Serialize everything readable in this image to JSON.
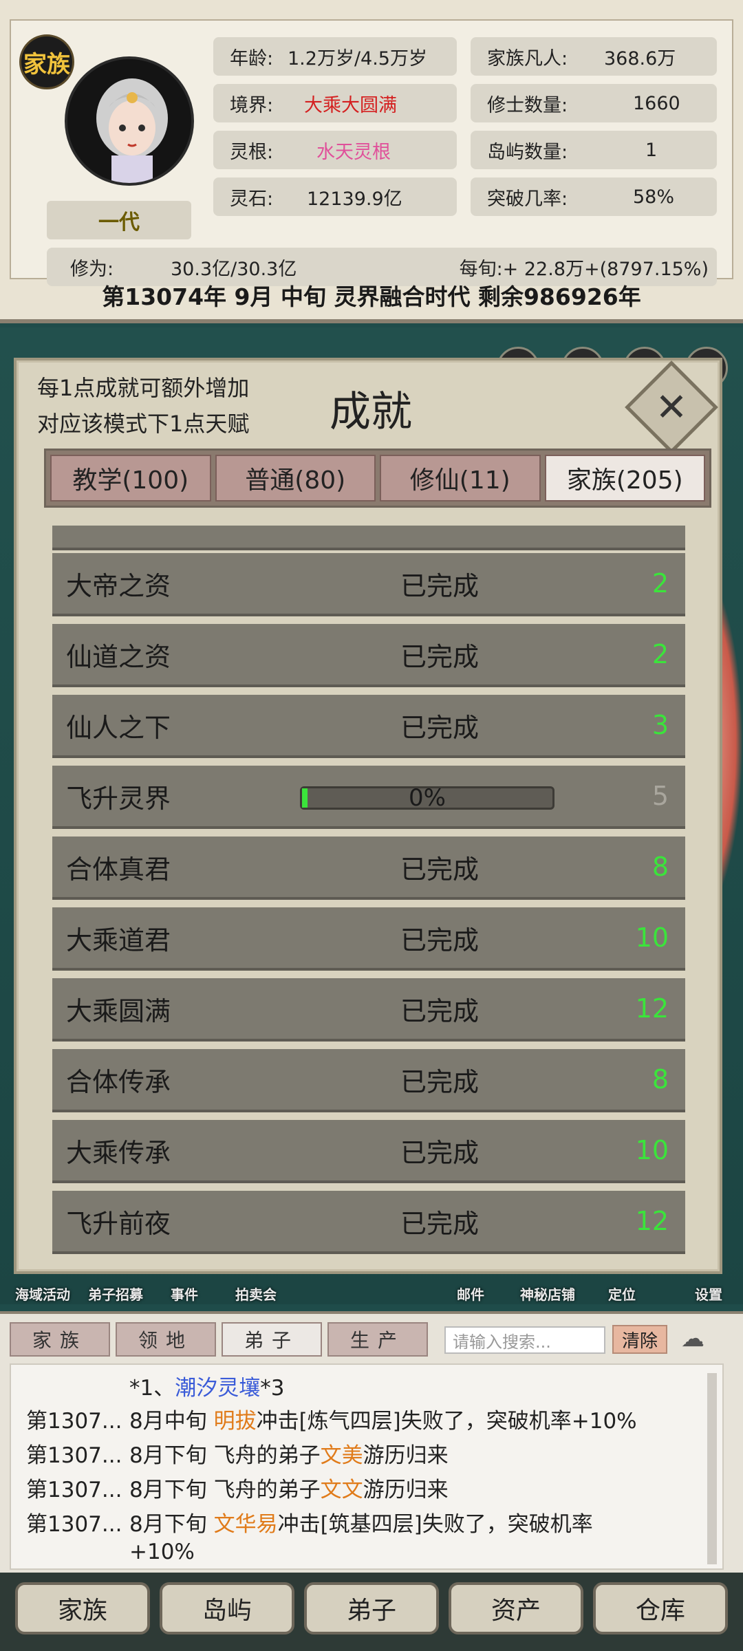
{
  "header": {
    "family_badge": "家族",
    "generation": "一代",
    "age_label": "年龄:",
    "age_value": "1.2万岁/4.5万岁",
    "realm_label": "境界:",
    "realm_value": "大乘大圆满",
    "root_label": "灵根:",
    "root_value": "水天灵根",
    "stone_label": "灵石:",
    "stone_value": "12139.9亿",
    "mortals_label": "家族凡人:",
    "mortals_value": "368.6万",
    "cultivators_label": "修士数量:",
    "cultivators_value": "1660",
    "islands_label": "岛屿数量:",
    "islands_value": "1",
    "breakthrough_label": "突破几率:",
    "breakthrough_value": "58%",
    "cultivation_label": "修为:",
    "cultivation_value": "30.3亿/30.3亿",
    "per_period": "每旬:+ 22.8万+(8797.15%)",
    "date_line": "第13074年 9月 中旬  灵界融合时代 剩余986926年"
  },
  "modal": {
    "note_line1": "每1点成就可额外增加",
    "note_line2": "对应该模式下1点天赋",
    "title": "成就",
    "close": "✕",
    "tabs": [
      "教学(100)",
      "普通(80)",
      "修仙(11)",
      "家族(205)"
    ],
    "rows": [
      {
        "name": "大帝之资",
        "status": "已完成",
        "points": "2"
      },
      {
        "name": "仙道之资",
        "status": "已完成",
        "points": "2"
      },
      {
        "name": "仙人之下",
        "status": "已完成",
        "points": "3"
      },
      {
        "name": "飞升灵界",
        "progress": "0%",
        "points": "5"
      },
      {
        "name": "合体真君",
        "status": "已完成",
        "points": "8"
      },
      {
        "name": "大乘道君",
        "status": "已完成",
        "points": "10"
      },
      {
        "name": "大乘圆满",
        "status": "已完成",
        "points": "12"
      },
      {
        "name": "合体传承",
        "status": "已完成",
        "points": "8"
      },
      {
        "name": "大乘传承",
        "status": "已完成",
        "points": "10"
      },
      {
        "name": "飞升前夜",
        "status": "已完成",
        "points": "12"
      }
    ]
  },
  "bottom_icons": [
    "海域活动",
    "弟子招募",
    "事件",
    "拍卖会",
    "邮件",
    "神秘店铺",
    "定位",
    "设置"
  ],
  "log": {
    "tabs": [
      "家族",
      "领地",
      "弟子",
      "生产"
    ],
    "search_placeholder": "请输入搜索...",
    "clear": "清除",
    "lines": [
      {
        "prefix": "",
        "seg1": "*1、",
        "name": "潮汐灵壤",
        "seg2": "*3"
      },
      {
        "prefix": "第1307...",
        "seg1": "8月中旬 ",
        "name": "明拔",
        "seg2": "冲击[炼气四层]失败了，突破机率+10%"
      },
      {
        "prefix": "第1307...",
        "seg1": "8月下旬 飞舟的弟子",
        "name": "文美",
        "seg2": "游历归来"
      },
      {
        "prefix": "第1307...",
        "seg1": "8月下旬 飞舟的弟子",
        "name": "文文",
        "seg2": "游历归来"
      },
      {
        "prefix": "第1307...",
        "seg1": "8月下旬 ",
        "name": "文华易",
        "seg2": "冲击[筑基四层]失败了，突破机率"
      },
      {
        "prefix": "",
        "seg1": "+10%",
        "name": "",
        "seg2": ""
      }
    ]
  },
  "nav": [
    "家族",
    "岛屿",
    "弟子",
    "资产",
    "仓库"
  ]
}
